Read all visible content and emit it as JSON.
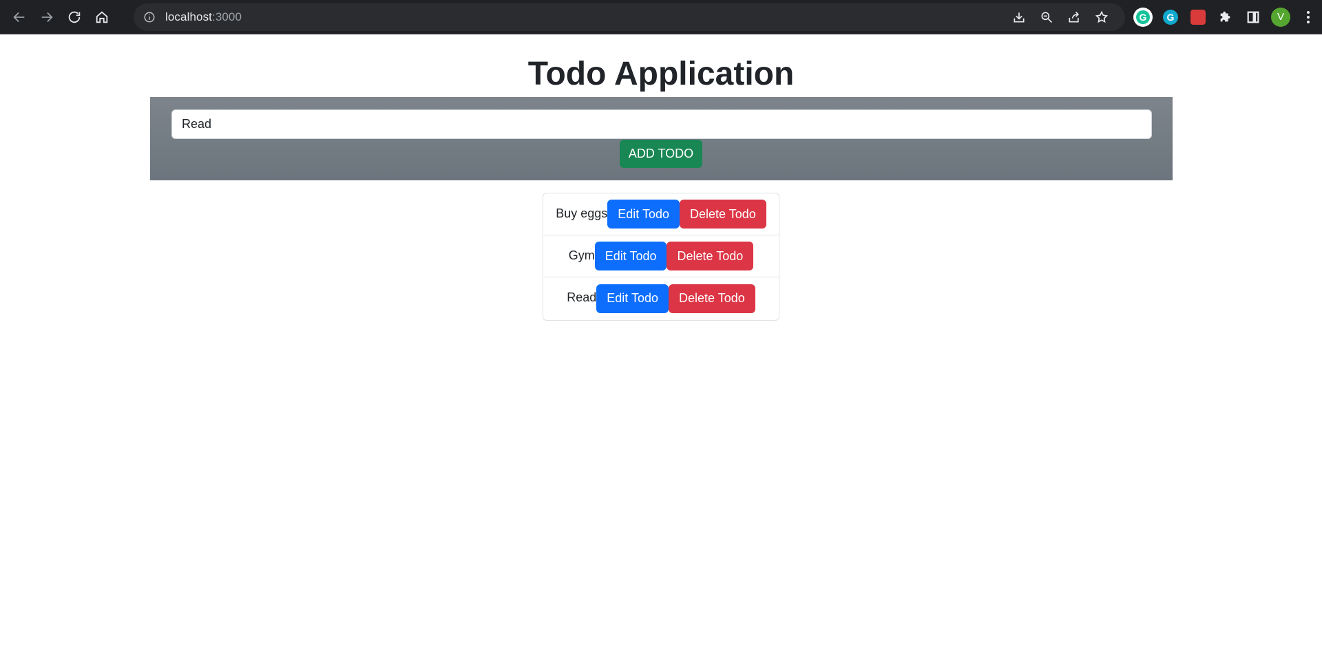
{
  "browser": {
    "url_host": "localhost",
    "url_port": ":3000",
    "profile_initial": "V",
    "grammarly_letter": "G",
    "grammarly2_letter": "G"
  },
  "page": {
    "title": "Todo Application"
  },
  "form": {
    "input_value": "Read",
    "add_button_label": "ADD TODO"
  },
  "todos": [
    {
      "text": "Buy eggs",
      "edit_label": "Edit Todo",
      "delete_label": "Delete Todo"
    },
    {
      "text": "Gym",
      "edit_label": "Edit Todo",
      "delete_label": "Delete Todo"
    },
    {
      "text": "Read",
      "edit_label": "Edit Todo",
      "delete_label": "Delete Todo"
    }
  ],
  "colors": {
    "panel": "#6c757d",
    "add_button": "#198754",
    "edit_button": "#0d6efd",
    "delete_button": "#dc3545"
  }
}
